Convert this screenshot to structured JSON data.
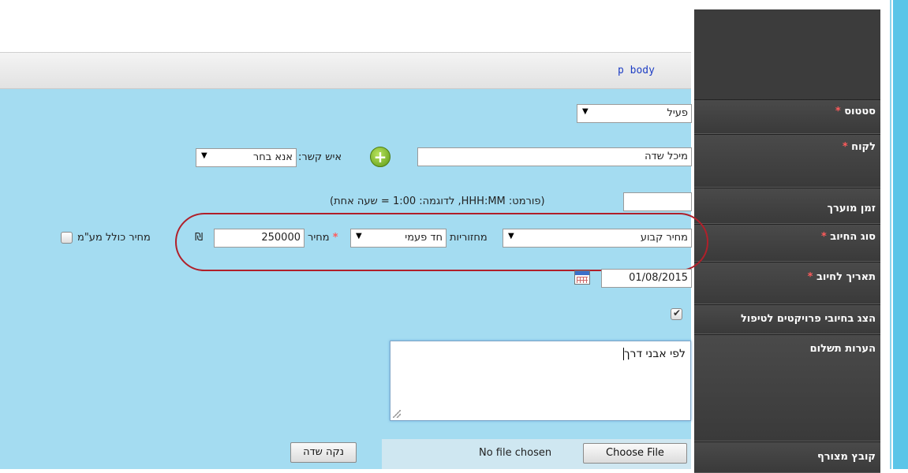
{
  "editor": {
    "element_path": "p  body"
  },
  "labels": {
    "status": "סטטוס",
    "customer": "לקוח",
    "estimated_time": "זמן מוערך",
    "charge_type": "סוג החיוב",
    "charge_date": "תאריך לחיוב",
    "show_in_project_charges": "הצג בחיובי פרויקטים לטיפול",
    "payment_notes": "הערות תשלום",
    "attached_file": "קובץ מצורף",
    "required_mark": "*"
  },
  "fields": {
    "status": {
      "value": "פעיל"
    },
    "customer": {
      "value": "מיכל שדה"
    },
    "contact": {
      "label": "איש קשר:",
      "value": "אנא בחר"
    },
    "estimated_time": {
      "value": "",
      "hint": "(פורמט: HHH:MM, לדוגמה: 1:00 = שעה אחת)"
    },
    "charge_type": {
      "value": "מחיר קבוע"
    },
    "recurrence": {
      "label": "מחזוריות",
      "value": "חד פעמי"
    },
    "price": {
      "label": "מחיר",
      "value": "250000",
      "currency": "₪"
    },
    "price_includes_vat": {
      "label": "מחיר כולל מע\"מ",
      "checked": false
    },
    "charge_date": {
      "value": "01/08/2015"
    },
    "show_in_project_charges": {
      "checked": true
    },
    "payment_notes": {
      "value": "לפי אבני דרך"
    },
    "attached_file": {
      "button": "Choose File",
      "status": "No file chosen",
      "clear_button": "נקה שדה"
    }
  },
  "icons": {
    "add_contact": "plus-circle-icon",
    "calendar": "calendar-icon",
    "dropdown": "▼"
  },
  "colors": {
    "form_background": "#a4dcf1",
    "label_background": "#3c3c3c",
    "required_star": "#ff5b5b",
    "highlight_ring": "#b0202a",
    "add_button": "#5e9a17"
  }
}
